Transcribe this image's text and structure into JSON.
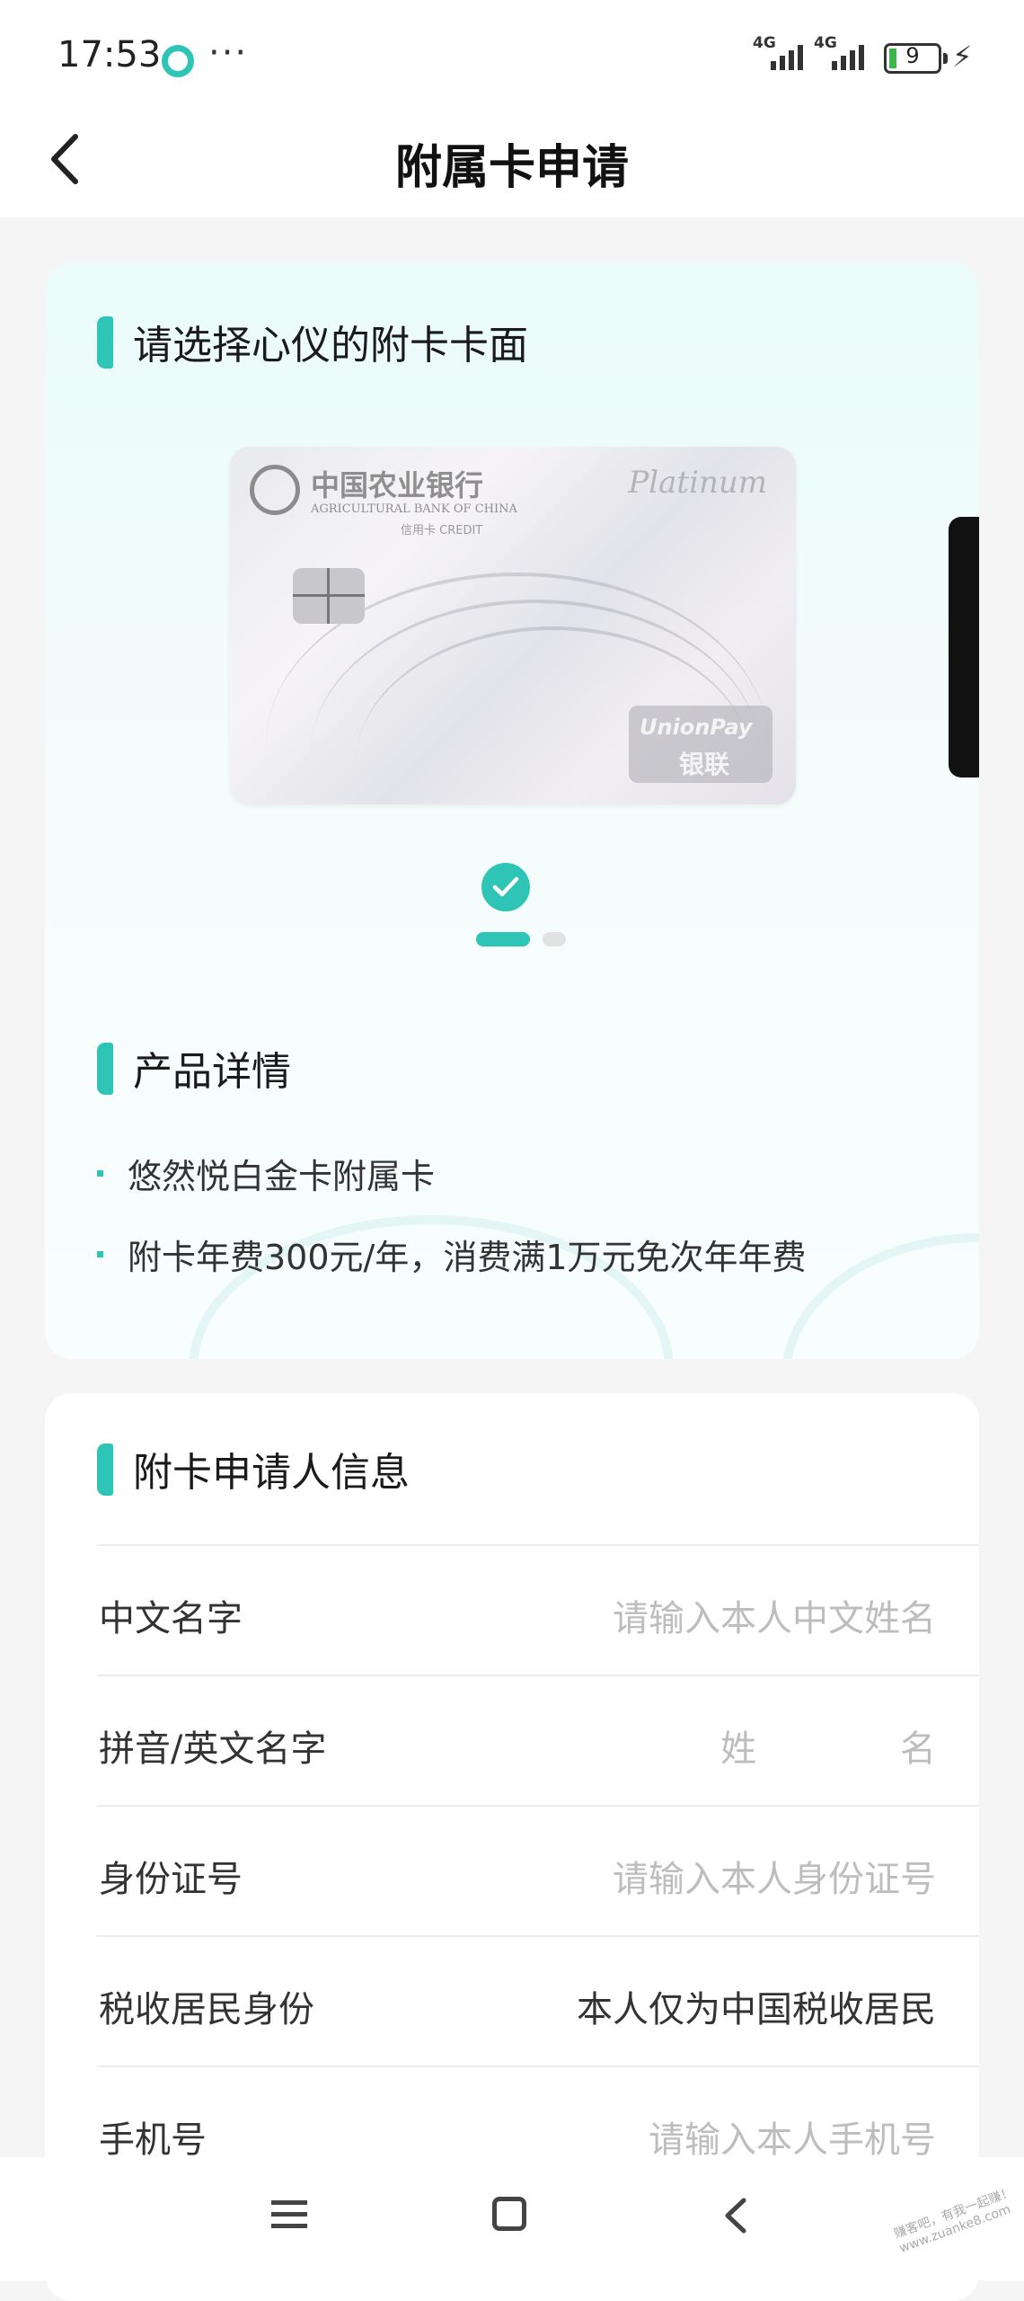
{
  "status_bar": {
    "time": "17:53",
    "more": "···",
    "signal1_label": "4G",
    "signal2_label": "4G",
    "battery_level": "9",
    "accent_color": "#2ec4b6"
  },
  "header": {
    "title": "附属卡申请",
    "back_icon": "chevron-left-icon"
  },
  "card_face_section": {
    "title": "请选择心仪的附卡卡面",
    "card": {
      "bank_name_cn": "中国农业银行",
      "bank_name_en": "AGRICULTURAL BANK OF CHINA",
      "card_type": "信用卡 CREDIT",
      "tier": "Platinum",
      "network_en": "UnionPay",
      "network_cn": "银联"
    },
    "pager": {
      "total": 2,
      "active": 1
    }
  },
  "product_section": {
    "title": "产品详情",
    "items": [
      "悠然悦白金卡附属卡",
      "附卡年费300元/年，消费满1万元免次年年费"
    ]
  },
  "applicant_section": {
    "title": "附卡申请人信息",
    "rows": {
      "chinese_name": {
        "label": "中文名字",
        "placeholder": "请输入本人中文姓名"
      },
      "pinyin_name": {
        "label": "拼音/英文名字",
        "surname_placeholder": "姓",
        "given_placeholder": "名"
      },
      "id_number": {
        "label": "身份证号",
        "placeholder": "请输入本人身份证号"
      },
      "tax_residency": {
        "label": "税收居民身份",
        "value": "本人仅为中国税收居民"
      },
      "phone": {
        "label": "手机号",
        "placeholder": "请输入本人手机号"
      }
    }
  },
  "watermark": "赚客吧，有我一起赚！ www.zuanke8.com"
}
